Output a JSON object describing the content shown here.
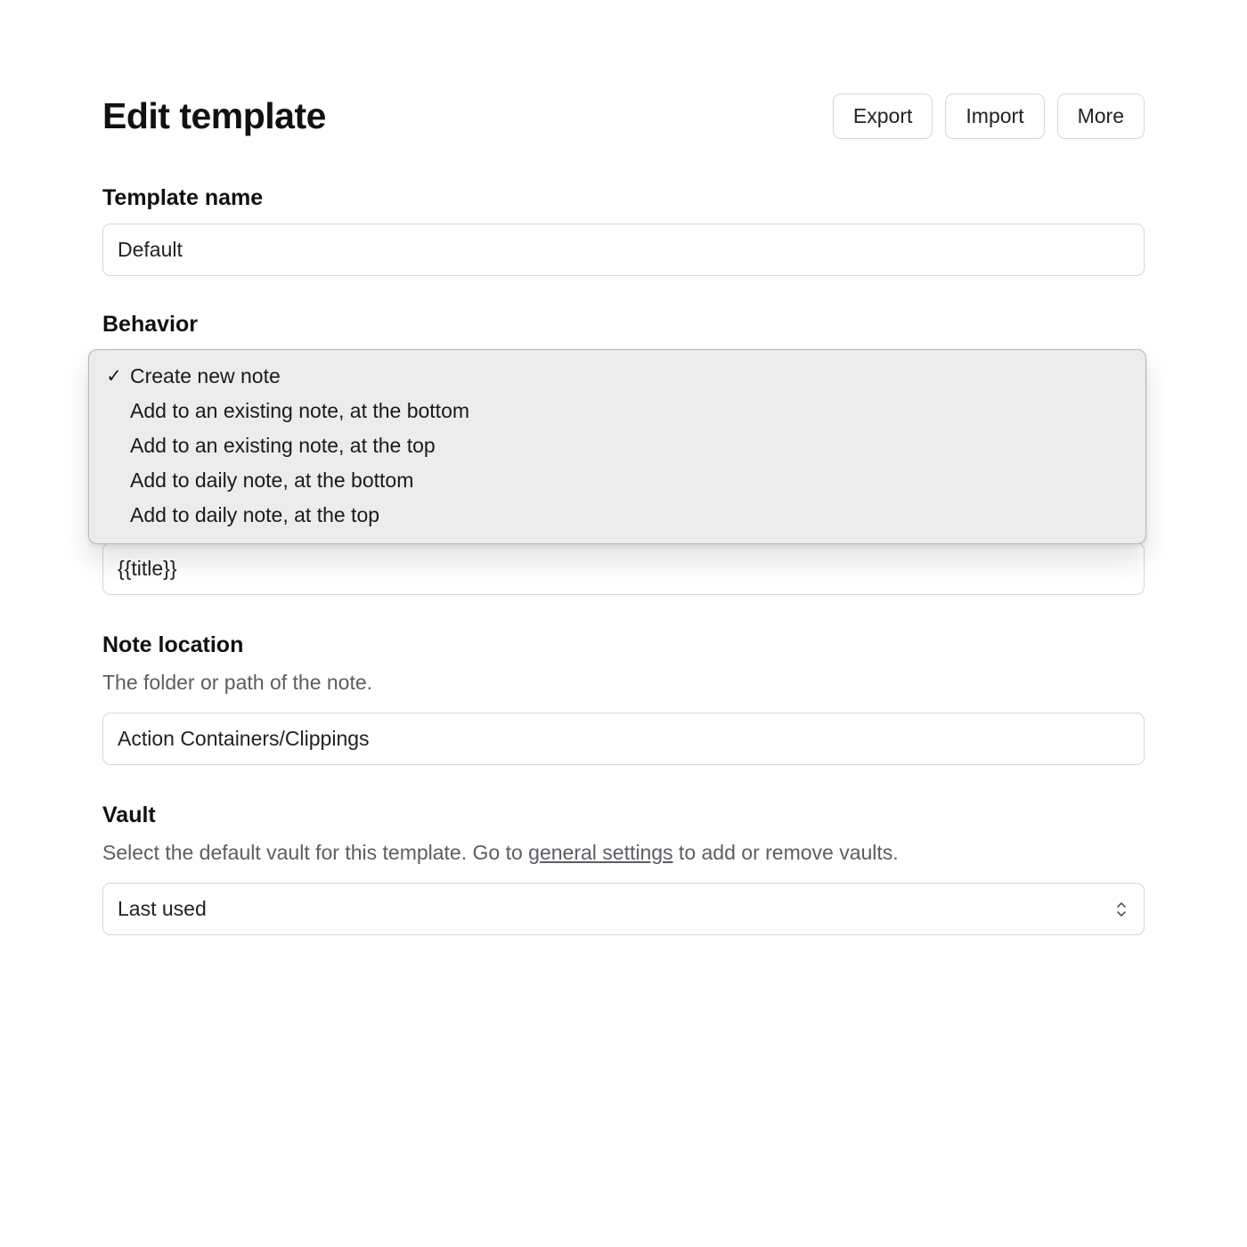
{
  "header": {
    "title": "Edit template",
    "buttons": {
      "export": "Export",
      "import": "Import",
      "more": "More"
    }
  },
  "template_name": {
    "label": "Template name",
    "value": "Default"
  },
  "behavior": {
    "label": "Behavior",
    "selected_index": 0,
    "options": [
      "Create new note",
      "Add to an existing note, at the bottom",
      "Add to an existing note, at the top",
      "Add to daily note, at the bottom",
      "Add to daily note, at the top"
    ]
  },
  "note_name": {
    "value": "{{title}}"
  },
  "note_location": {
    "label": "Note location",
    "helper": "The folder or path of the note.",
    "value": "Action Containers/Clippings"
  },
  "vault": {
    "label": "Vault",
    "helper_pre": "Select the default vault for this template. Go to ",
    "helper_link": "general settings",
    "helper_post": " to add or remove vaults.",
    "selected": "Last used"
  }
}
